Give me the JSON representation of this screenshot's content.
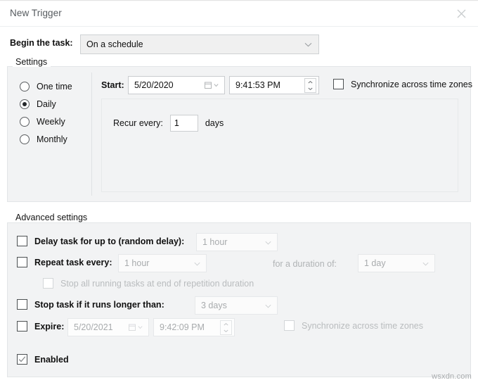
{
  "window": {
    "title": "New Trigger",
    "close_icon": "close-icon"
  },
  "begin": {
    "label": "Begin the task:",
    "value": "On a schedule",
    "chevron_icon": "chevron-down-icon"
  },
  "settings": {
    "legend": "Settings",
    "schedule_options": [
      {
        "label": "One time",
        "checked": false
      },
      {
        "label": "Daily",
        "checked": true
      },
      {
        "label": "Weekly",
        "checked": false
      },
      {
        "label": "Monthly",
        "checked": false
      }
    ],
    "start": {
      "label": "Start:",
      "date": "5/20/2020",
      "time": "9:41:53 PM",
      "calendar_icon": "calendar-icon",
      "spinner_icon": "spinner-up-down-icon"
    },
    "sync": {
      "label": "Synchronize across time zones",
      "checked": false
    },
    "recur": {
      "label": "Recur every:",
      "value": "1",
      "unit": "days"
    }
  },
  "advanced": {
    "legend": "Advanced settings",
    "delay": {
      "label": "Delay task for up to (random delay):",
      "checked": false,
      "value": "1 hour"
    },
    "repeat": {
      "label": "Repeat task every:",
      "checked": false,
      "value": "1 hour",
      "duration_label": "for a duration of:",
      "duration_value": "1 day"
    },
    "stop_all": {
      "label": "Stop all running tasks at end of repetition duration",
      "checked": false
    },
    "stop_longer": {
      "label": "Stop task if it runs longer than:",
      "checked": false,
      "value": "3 days"
    },
    "expire": {
      "label": "Expire:",
      "checked": false,
      "date": "5/20/2021",
      "time": "9:42:09 PM"
    },
    "expire_sync": {
      "label": "Synchronize across time zones",
      "checked": false
    },
    "enabled": {
      "label": "Enabled",
      "checked": true
    }
  },
  "watermark": "wsxdn.com",
  "colors": {
    "group_bg": "#f2f3f4",
    "combo_bg": "#f0f0f0",
    "text": "#101010",
    "disabled_text": "#a8abad"
  }
}
